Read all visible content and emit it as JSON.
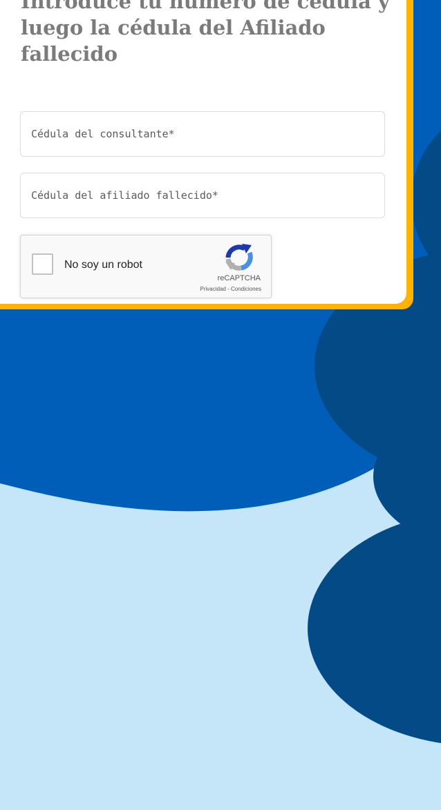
{
  "form": {
    "heading_lines": [
      "Introduce tu número de cédula y",
      "luego la cédula del Afiliado",
      "fallecido"
    ],
    "consultant_id_placeholder": "Cédula del consultante*",
    "deceased_id_placeholder": "Cédula del afiliado fallecido*"
  },
  "recaptcha": {
    "label": "No soy un robot",
    "brand": "reCAPTCHA",
    "privacy": "Privacidad",
    "separator": " - ",
    "terms": "Condiciones",
    "logo_icon": "recaptcha-logo-icon"
  },
  "colors": {
    "page_bg": "#c5e5f8",
    "brand_blue": "#005eb8",
    "dark_blue": "#034a86",
    "accent_yellow": "#ffb300",
    "heading_gray": "#7b7b7b"
  }
}
